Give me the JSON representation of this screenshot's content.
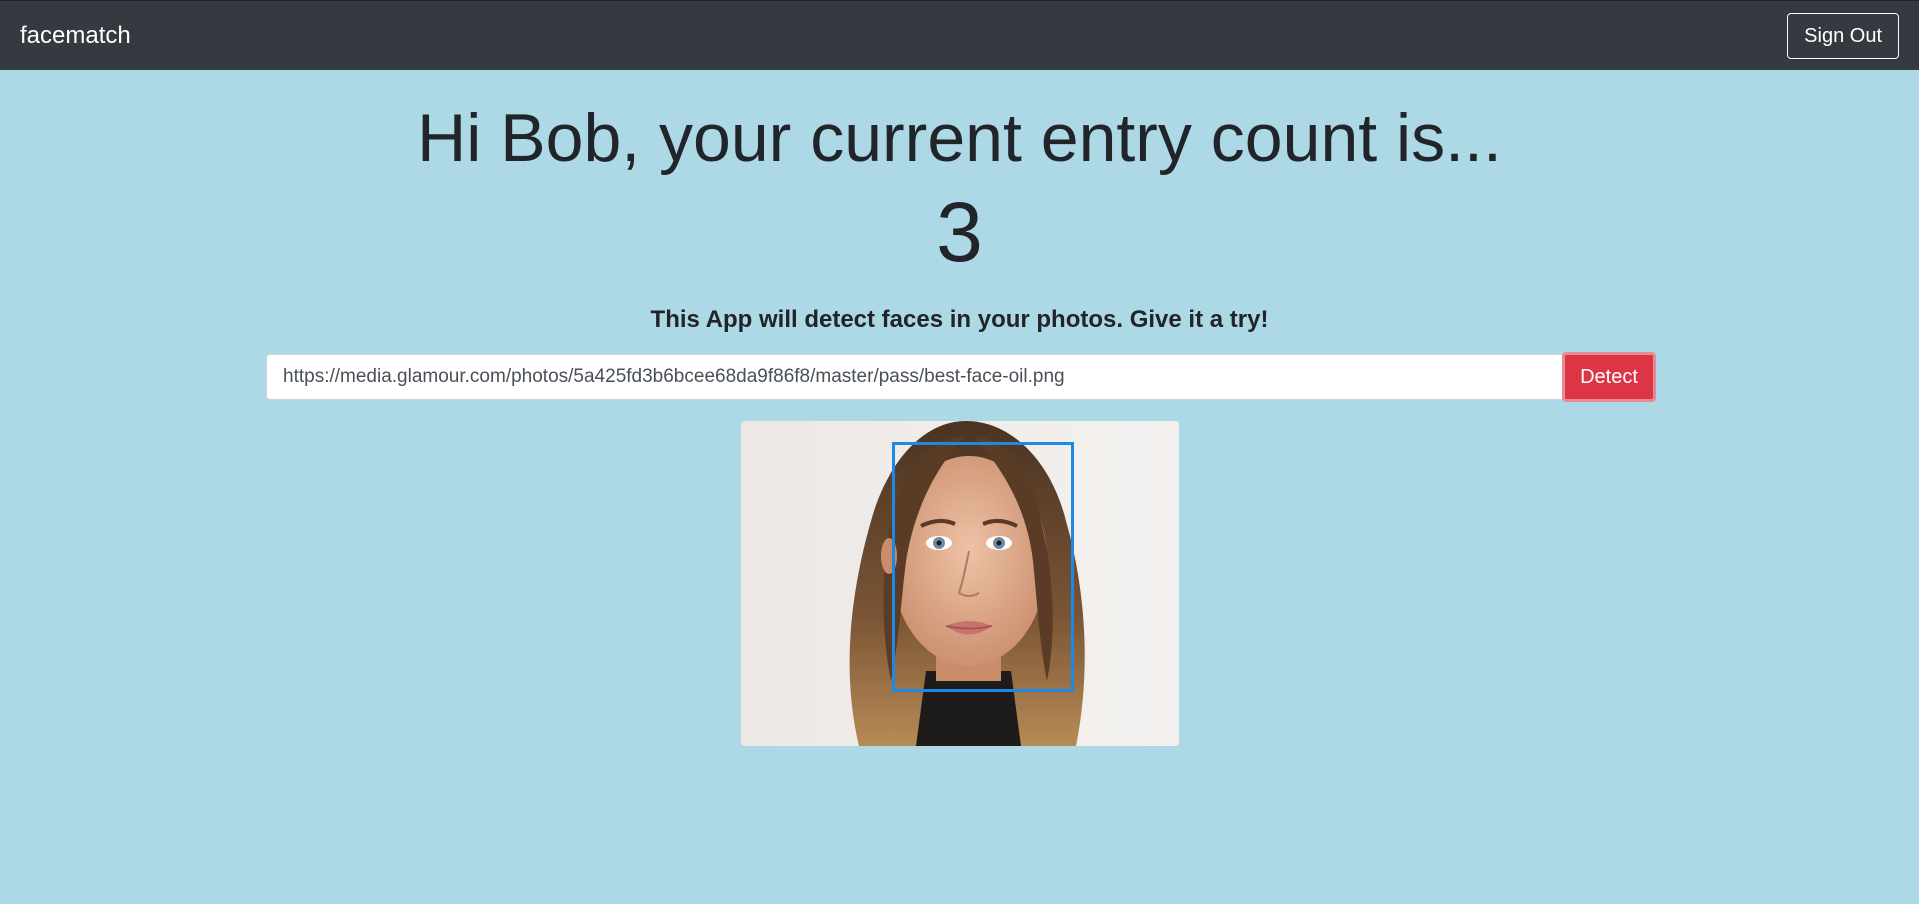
{
  "navbar": {
    "brand": "facematch",
    "signout_label": "Sign Out"
  },
  "main": {
    "greeting": "Hi Bob, your current entry count is...",
    "entry_count": "3",
    "tagline": "This App will detect faces in your photos. Give it a try!"
  },
  "form": {
    "url_value": "https://media.glamour.com/photos/5a425fd3b6bcee68da9f86f8/master/pass/best-face-oil.png",
    "detect_label": "Detect"
  },
  "colors": {
    "navbar_bg": "#343a40",
    "page_bg": "#add8e6",
    "detect_bg": "#dc3545",
    "face_box": "#1e88e5"
  }
}
